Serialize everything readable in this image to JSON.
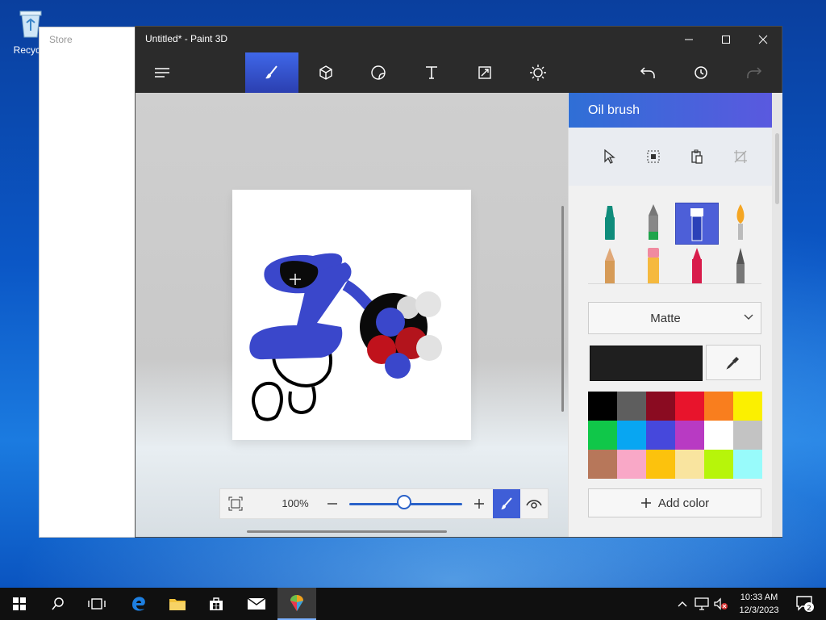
{
  "desktop": {
    "recycle_label": "Recycle"
  },
  "store": {
    "title": "Store"
  },
  "window": {
    "title": "Untitled* - Paint 3D",
    "minimize": "minimize-icon",
    "maximize": "maximize-icon",
    "close": "close-icon"
  },
  "toolbar": {
    "items": [
      "menu-icon",
      "brushes-icon",
      "3d-shapes-icon",
      "stickers-icon",
      "text-icon",
      "canvas-icon",
      "effects-icon",
      "undo-icon",
      "history-icon",
      "redo-icon"
    ],
    "active": "brushes"
  },
  "zoom": {
    "value": "100%",
    "level": 0.5
  },
  "sidebar": {
    "header": "Oil brush",
    "finish": "Matte",
    "add_color": "Add color",
    "current_color": "#1f1f1f",
    "palette": [
      "#000000",
      "#5e5e5e",
      "#8a0b21",
      "#e8142c",
      "#f97e1e",
      "#fbf000",
      "#10c749",
      "#08a6f2",
      "#4648dc",
      "#b83ac3",
      "#ffffff",
      "#c3c3c3",
      "#b7775a",
      "#f9a8c7",
      "#fcc20d",
      "#f9e49f",
      "#b7f50a",
      "#98fbfb"
    ]
  },
  "taskbar": {
    "time": "10:33 AM",
    "date": "12/3/2023",
    "notifications": "2"
  }
}
